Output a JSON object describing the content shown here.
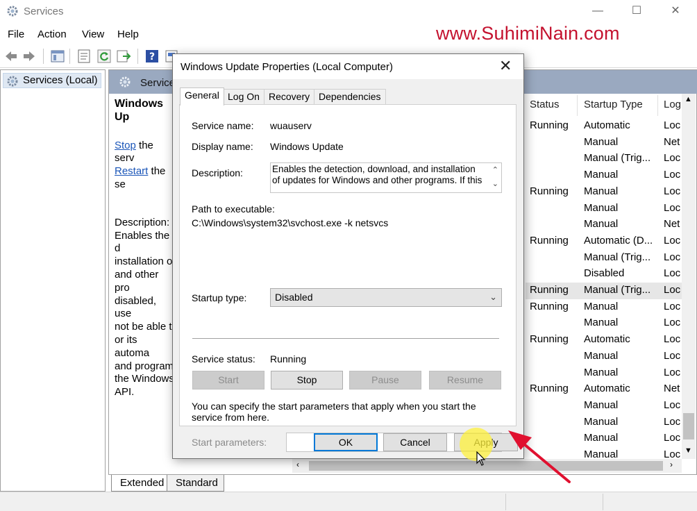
{
  "window": {
    "title": "Services",
    "controls": {
      "minimize": "—",
      "maximize": "☐",
      "close": "✕"
    }
  },
  "menu": [
    "File",
    "Action",
    "View",
    "Help"
  ],
  "watermark": "www.SuhimiNain.com",
  "tree": {
    "root": "Services (Local)"
  },
  "panel": {
    "header": "Service",
    "service_name": "Windows Up",
    "stop_link": "Stop",
    "stop_rest": " the serv",
    "restart_link": "Restart",
    "restart_rest": " the se",
    "desc_label": "Description:",
    "desc_lines": [
      "Enables the d",
      "installation o",
      "and other pro",
      "disabled, use",
      "not be able t",
      "or its automa",
      "and program",
      "the Windows",
      "API."
    ]
  },
  "columns": {
    "status": "Status",
    "startup": "Startup Type",
    "log": "Log"
  },
  "rows": [
    {
      "status": "Running",
      "startup": "Automatic",
      "log": "Loc"
    },
    {
      "status": "",
      "startup": "Manual",
      "log": "Net"
    },
    {
      "status": "",
      "startup": "Manual (Trig...",
      "log": "Loc"
    },
    {
      "status": "",
      "startup": "Manual",
      "log": "Loc"
    },
    {
      "status": "Running",
      "startup": "Manual",
      "log": "Loc"
    },
    {
      "status": "",
      "startup": "Manual",
      "log": "Loc"
    },
    {
      "status": "",
      "startup": "Manual",
      "log": "Net"
    },
    {
      "status": "Running",
      "startup": "Automatic (D...",
      "log": "Loc"
    },
    {
      "status": "",
      "startup": "Manual (Trig...",
      "log": "Loc"
    },
    {
      "status": "",
      "startup": "Disabled",
      "log": "Loc"
    },
    {
      "status": "Running",
      "startup": "Manual (Trig...",
      "log": "Loc"
    },
    {
      "status": "Running",
      "startup": "Manual",
      "log": "Loc"
    },
    {
      "status": "",
      "startup": "Manual",
      "log": "Loc"
    },
    {
      "status": "Running",
      "startup": "Automatic",
      "log": "Loc"
    },
    {
      "status": "",
      "startup": "Manual",
      "log": "Loc"
    },
    {
      "status": "",
      "startup": "Manual",
      "log": "Loc"
    },
    {
      "status": "Running",
      "startup": "Automatic",
      "log": "Net"
    },
    {
      "status": "",
      "startup": "Manual",
      "log": "Loc"
    },
    {
      "status": "",
      "startup": "Manual",
      "log": "Loc"
    },
    {
      "status": "",
      "startup": "Manual",
      "log": "Loc"
    },
    {
      "status": "",
      "startup": "Manual",
      "log": "Loc"
    }
  ],
  "bottom_tabs": [
    "Extended",
    "Standard"
  ],
  "dialog": {
    "title": "Windows Update Properties (Local Computer)",
    "close": "✕",
    "tabs": [
      "General",
      "Log On",
      "Recovery",
      "Dependencies"
    ],
    "service_name_label": "Service name:",
    "service_name": "wuauserv",
    "display_name_label": "Display name:",
    "display_name": "Windows Update",
    "description_label": "Description:",
    "description": "Enables the detection, download, and installation of updates for Windows and other programs. If this",
    "path_label": "Path to executable:",
    "path": "C:\\Windows\\system32\\svchost.exe -k netsvcs",
    "startup_type_label": "Startup type:",
    "startup_type": "Disabled",
    "service_status_label": "Service status:",
    "service_status": "Running",
    "buttons": {
      "start": "Start",
      "stop": "Stop",
      "pause": "Pause",
      "resume": "Resume"
    },
    "param_text": "You can specify the start parameters that apply when you start the service from here.",
    "start_params_label": "Start parameters:",
    "start_params_value": "",
    "ok": "OK",
    "cancel": "Cancel",
    "apply": "Apply"
  },
  "colors": {
    "accent": "#0078d7",
    "panel_header": "#9aa9c0",
    "watermark": "#c4122f",
    "annotation_arrow": "#e0102f"
  }
}
